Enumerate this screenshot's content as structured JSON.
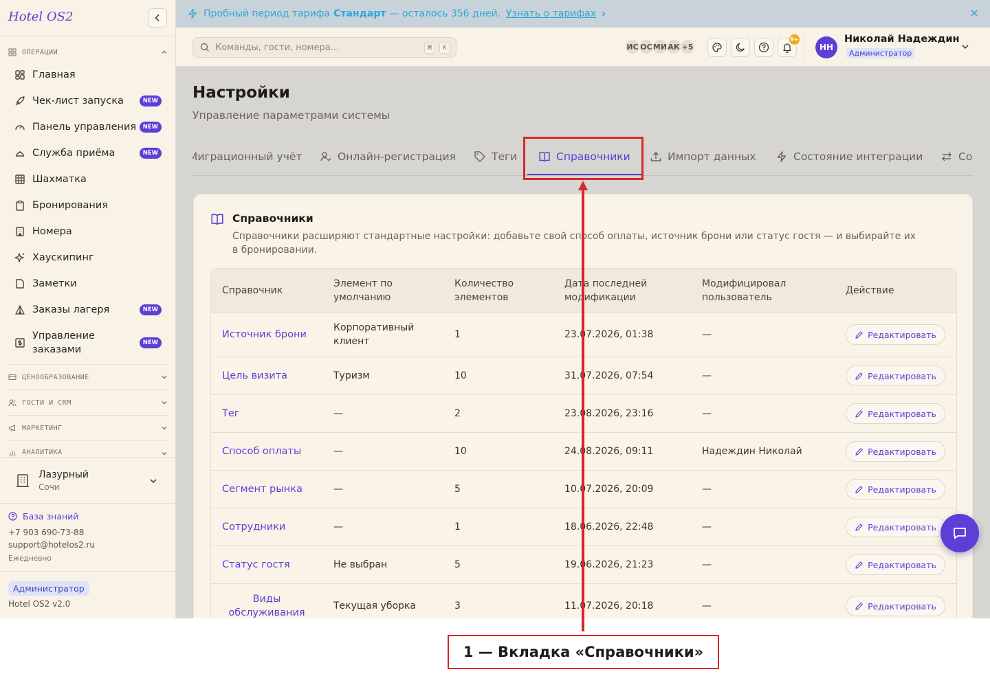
{
  "sidebar": {
    "brand": "Hotel OS2",
    "sections": {
      "operations": "ОПЕРАЦИИ",
      "pricing": "ЦЕНООБРАЗОВАНИЕ",
      "guests": "ГОСТИ И CRM",
      "marketing": "МАРКЕТИНГ",
      "analytics": "АНАЛИТИКА"
    },
    "items": [
      {
        "label": "Главная",
        "icon": "grid-icon",
        "badge": ""
      },
      {
        "label": "Чек-лист запуска",
        "icon": "rocket-icon",
        "badge": "NEW"
      },
      {
        "label": "Панель управления",
        "icon": "gauge-icon",
        "badge": "NEW"
      },
      {
        "label": "Служба приёма",
        "icon": "bell-service-icon",
        "badge": "NEW"
      },
      {
        "label": "Шахматка",
        "icon": "table-grid-icon",
        "badge": ""
      },
      {
        "label": "Бронирования",
        "icon": "clipboard-icon",
        "badge": ""
      },
      {
        "label": "Номера",
        "icon": "building-icon",
        "badge": ""
      },
      {
        "label": "Хаускипинг",
        "icon": "sparkles-icon",
        "badge": ""
      },
      {
        "label": "Заметки",
        "icon": "note-icon",
        "badge": ""
      },
      {
        "label": "Заказы лагеря",
        "icon": "tent-icon",
        "badge": "NEW"
      },
      {
        "label": "Управление заказами",
        "icon": "dollar-icon",
        "badge": "NEW"
      }
    ],
    "hotel": {
      "name": "Лазурный",
      "city": "Сочи"
    },
    "knowledge_base": "База знаний",
    "phone": "+7 903 690-73-88",
    "email": "support@hotelos2.ru",
    "schedule": "Ежедневно",
    "role": "Администратор",
    "version": "Hotel OS2 v2.0"
  },
  "banner": {
    "text_before": "Пробный период тарифа",
    "plan": "Стандарт",
    "text_after": "— осталось 356 дней.",
    "link": "Узнать о тарифах",
    "accent": "#2ea7dc"
  },
  "topbar": {
    "search_placeholder": "Команды, гости, номера...",
    "kbd1": "⌘",
    "kbd2": "K",
    "avatars": [
      "ИС",
      "ОС",
      "МИ",
      "АК",
      "+5"
    ],
    "notif_count": "9+",
    "user_initials": "НН",
    "user_name": "Николай Надеждин",
    "user_role": "Администратор"
  },
  "page": {
    "title": "Настройки",
    "subtitle": "Управление параметрами системы"
  },
  "tabs": [
    {
      "label": "Миграционный учёт",
      "icon": ""
    },
    {
      "label": "Онлайн-регистрация",
      "icon": "user-check-icon"
    },
    {
      "label": "Теги",
      "icon": "tag-icon"
    },
    {
      "label": "Справочники",
      "icon": "book-icon",
      "active": true
    },
    {
      "label": "Импорт данных",
      "icon": "upload-icon"
    },
    {
      "label": "Состояние интеграции",
      "icon": "bolt-icon"
    },
    {
      "label": "Со",
      "icon": "arrows-icon"
    }
  ],
  "card": {
    "title": "Справочники",
    "description": "Справочники расширяют стандартные настройки: добавьте свой способ оплаты, источник брони или статус гостя — и выбирайте их в бронировании."
  },
  "table": {
    "headers": [
      "Справочник",
      "Элемент по умолчанию",
      "Количество элементов",
      "Дата последней модификации",
      "Модифицировал пользователь",
      "Действие"
    ],
    "rows": [
      {
        "name": "Источник брони",
        "default": "Корпоративный клиент",
        "count": "1",
        "date": "23.07.2026, 01:38",
        "user": "—"
      },
      {
        "name": "Цель визита",
        "default": "Туризм",
        "count": "10",
        "date": "31.07.2026, 07:54",
        "user": "—"
      },
      {
        "name": "Тег",
        "default": "—",
        "count": "2",
        "date": "23.08.2026, 23:16",
        "user": "—"
      },
      {
        "name": "Способ оплаты",
        "default": "—",
        "count": "10",
        "date": "24.08.2026, 09:11",
        "user": "Надеждин Николай"
      },
      {
        "name": "Сегмент рынка",
        "default": "—",
        "count": "5",
        "date": "10.07.2026, 20:09",
        "user": "—"
      },
      {
        "name": "Сотрудники",
        "default": "—",
        "count": "1",
        "date": "18.06.2026, 22:48",
        "user": "—"
      },
      {
        "name": "Статус гостя",
        "default": "Не выбран",
        "count": "5",
        "date": "19.06.2026, 21:23",
        "user": "—"
      },
      {
        "name": "Виды обслуживания",
        "default": "Текущая уборка",
        "count": "3",
        "date": "11.07.2026, 20:18",
        "user": "—"
      }
    ],
    "action_label": "Редактировать"
  },
  "annotation": {
    "label": "1 — Вкладка «Справочники»",
    "color": "#d62828"
  },
  "colors": {
    "accent": "#5b3fd6",
    "sidebar_bg": "#f8f2e7",
    "badge": "#5b3fd6"
  }
}
